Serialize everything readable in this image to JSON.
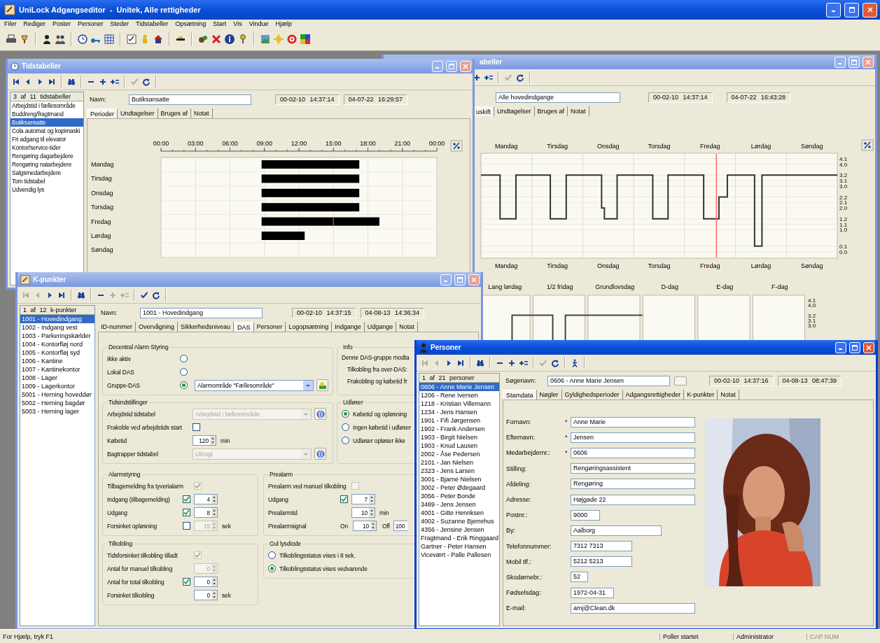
{
  "app": {
    "title": "UniLock Adgangseditor  -  Unitek, Alle rettigheder",
    "menu": [
      "Filer",
      "Rediger",
      "Poster",
      "Personer",
      "Steder",
      "Tidstabeller",
      "Opsætning",
      "Start",
      "Vis",
      "Vindue",
      "Hjælp"
    ]
  },
  "week_window": {
    "title": "abeller",
    "active": false,
    "toolbar": [
      {
        "kind": "add",
        "disabled": false
      },
      {
        "kind": "copy",
        "disabled": false
      },
      {
        "kind": "save",
        "disabled": true
      },
      {
        "kind": "undo",
        "disabled": false
      }
    ],
    "name": "Alle hovedindgange",
    "created": "00-02-10 14:37:14",
    "modified": "04-07-22 16:43:28",
    "tabs": [
      {
        "label": "uskift",
        "selected": true
      },
      {
        "label": "Undtagelser",
        "selected": false
      },
      {
        "label": "Bruges af",
        "selected": false
      },
      {
        "label": "Notat",
        "selected": false
      }
    ],
    "day_headers": [
      "Mandag",
      "Tirsdag",
      "Onsdag",
      "Torsdag",
      "Fredag",
      "Lørdag",
      "Søndag"
    ],
    "level_labels": [
      "4.1",
      "4.0",
      "3.2",
      "3.1",
      "3.0",
      "2.2",
      "2.1",
      "2.0",
      "1.2",
      "1.1",
      "1.0",
      "0.1",
      "0.0"
    ],
    "day_footers": [
      "Mandag",
      "Tirsdag",
      "Onsdag",
      "Torsdag",
      "Fredag",
      "Lørdag",
      "Søndag"
    ],
    "special_days": [
      "Lang lørdag",
      "1/2 fridag",
      "Grundlovsdag",
      "D-dag",
      "E-dag",
      "F-dag"
    ],
    "special_levels": [
      "4.1",
      "4.0",
      "3.2",
      "3.1",
      "3.0"
    ]
  },
  "timetable_window": {
    "title": "Tidstabeller",
    "active": false,
    "toolbar": [
      {
        "kind": "first",
        "disabled": false
      },
      {
        "kind": "prev",
        "disabled": false
      },
      {
        "kind": "next",
        "disabled": false
      },
      {
        "kind": "last",
        "disabled": false
      },
      {
        "kind": "find",
        "disabled": false
      },
      {
        "kind": "delete",
        "disabled": false
      },
      {
        "kind": "add",
        "disabled": false
      },
      {
        "kind": "copy",
        "disabled": false
      },
      {
        "kind": "save",
        "disabled": true
      },
      {
        "kind": "undo",
        "disabled": false
      }
    ],
    "list_header": "3 af 11 tidstabeller",
    "items": [
      {
        "label": "Arbejdstid i fællesområde",
        "selected": false
      },
      {
        "label": "Buddreng/fragtmand",
        "selected": false
      },
      {
        "label": "Butiksansatte",
        "selected": true
      },
      {
        "label": "Cola automat og kopimaski",
        "selected": false
      },
      {
        "label": "Fri adgang til elevator",
        "selected": false
      },
      {
        "label": "Kontor/service-tider",
        "selected": false
      },
      {
        "label": "Rengøring dagarbejdere",
        "selected": false
      },
      {
        "label": "Rengøring natarbejdere",
        "selected": false
      },
      {
        "label": "Salgsmedarbejdere",
        "selected": false
      },
      {
        "label": "Tom tidstabel",
        "selected": false
      },
      {
        "label": "Udvendig lys",
        "selected": false
      }
    ],
    "name_label": "Navn:",
    "name": "Butiksansatte",
    "created": "00-02-10 14:37:14",
    "modified": "04-07-22 16:29:57",
    "tabs": [
      {
        "label": "Perioder",
        "selected": true
      },
      {
        "label": "Undtagelser",
        "selected": false
      },
      {
        "label": "Bruges af",
        "selected": false
      },
      {
        "label": "Notat",
        "selected": false
      }
    ],
    "hour_labels": [
      "00:00",
      "03:00",
      "06:00",
      "09:00",
      "12:00",
      "15:00",
      "18:00",
      "21:00",
      "00:00"
    ],
    "days": [
      "Mandag",
      "Tirsdag",
      "Onsdag",
      "Torsdag",
      "Fredag",
      "Lørdag",
      "Søndag"
    ]
  },
  "kpoint_window": {
    "title": "K-punkter",
    "active": false,
    "toolbar": [
      {
        "kind": "first",
        "disabled": true
      },
      {
        "kind": "prev",
        "disabled": true
      },
      {
        "kind": "next",
        "disabled": false
      },
      {
        "kind": "last",
        "disabled": false
      },
      {
        "kind": "find",
        "disabled": false
      },
      {
        "kind": "delete",
        "disabled": false
      },
      {
        "kind": "add",
        "disabled": true
      },
      {
        "kind": "copy",
        "disabled": true
      },
      {
        "kind": "save",
        "disabled": false
      },
      {
        "kind": "undo",
        "disabled": false
      }
    ],
    "list_header": "1 af 12 k-punkter",
    "items": [
      {
        "label": "1001 - Hovedindgang",
        "selected": true
      },
      {
        "label": "1002 - Indgang vest",
        "selected": false
      },
      {
        "label": "1003 - Parkeringskælder",
        "selected": false
      },
      {
        "label": "1004 - Kontorfløj nord",
        "selected": false
      },
      {
        "label": "1005 - Kontorfløj syd",
        "selected": false
      },
      {
        "label": "1006 - Kantine",
        "selected": false
      },
      {
        "label": "1007 - Kantinekontor",
        "selected": false
      },
      {
        "label": "1008 - Lager",
        "selected": false
      },
      {
        "label": "1009 - Lagerkontor",
        "selected": false
      },
      {
        "label": "5001 - Herning hoveddør",
        "selected": false
      },
      {
        "label": "5002 - Herning bagdør",
        "selected": false
      },
      {
        "label": "5003 - Herning lager",
        "selected": false
      }
    ],
    "name_label": "Navn:",
    "name": "1001 - Hovedindgang",
    "created": "00-02-10 14:37:15",
    "modified": "04-08-13 14:36:34",
    "tabs": [
      {
        "label": "ID-nummer",
        "selected": false
      },
      {
        "label": "Overvågning",
        "selected": false
      },
      {
        "label": "Sikkerhedsniveau",
        "selected": false
      },
      {
        "label": "DAS",
        "selected": true
      },
      {
        "label": "Personer",
        "selected": false
      },
      {
        "label": "Logopsætning",
        "selected": false
      },
      {
        "label": "Indgange",
        "selected": false
      },
      {
        "label": "Udgange",
        "selected": false
      },
      {
        "label": "Notat",
        "selected": false
      }
    ],
    "decentral": {
      "title": "Decentral Alarm Styring",
      "options": [
        {
          "label": "Ikke aktiv",
          "selected": false
        },
        {
          "label": "Lokal DAS",
          "selected": false
        },
        {
          "label": "Gruppe-DAS",
          "selected": true,
          "value": "Alarmområde \"Fællesområde\""
        }
      ]
    },
    "info": {
      "title": "Info",
      "lines": [
        "Denne DAS-gruppe modta",
        "Tilkobling fra over-DAS:",
        "Frakobling og købetid fr"
      ]
    },
    "time_settings": {
      "title": "Tidsindstillinger",
      "rows": [
        {
          "kind": "dropdown",
          "label": "Arbejdstid tidstabel",
          "value": "Arbejdstid i fællesområde",
          "disabled": true
        },
        {
          "kind": "check",
          "label": "Frakoble ved arbejdstids start",
          "checked": false,
          "disabled": false
        },
        {
          "kind": "spin",
          "label": "Købetid",
          "value": "120",
          "unit": "min",
          "disabled": false
        },
        {
          "kind": "dropdown",
          "label": "Bagtrapper tidstabel",
          "value": "Ubrugt",
          "disabled": true
        }
      ]
    },
    "trigger": {
      "title": "Udløser",
      "options": [
        {
          "label": "Købetid og opløsning",
          "selected": true
        },
        {
          "label": "Ingen købetid i udløser",
          "selected": false
        },
        {
          "label": "Udløser opløser ikke",
          "selected": false
        }
      ]
    },
    "alarm": {
      "title": "Alarmstyring",
      "rows": [
        {
          "kind": "check",
          "label": "Tilbagemelding fra tyverialarm",
          "checked": true,
          "disabled": true
        },
        {
          "kind": "check_spin",
          "label": "Indgang (tilbagemelding)",
          "checked": true,
          "disabled": false,
          "value": "4"
        },
        {
          "kind": "check_spin",
          "label": "Udgang",
          "checked": true,
          "disabled": false,
          "value": "8"
        },
        {
          "kind": "check_spin",
          "label": "Forsinket opløsning",
          "checked": false,
          "disabled": true,
          "value": "15",
          "unit": "sek"
        }
      ]
    },
    "prealarm": {
      "title": "Prealarm",
      "rows": [
        {
          "kind": "check",
          "label": "Prealarm ved manuel tilkobling",
          "checked": false,
          "disabled": true
        },
        {
          "kind": "check_spin",
          "label": "Udgang",
          "checked": true,
          "disabled": false,
          "value": "7"
        },
        {
          "kind": "spin",
          "label": "Prealarmtid",
          "value": "10",
          "unit": "min",
          "disabled": false
        },
        {
          "kind": "signal",
          "label": "Prealarmsignal",
          "on_label": "On",
          "on_value": "10",
          "off_label": "Off",
          "off_value": "100"
        }
      ]
    },
    "arming": {
      "title": "Tilkobling",
      "rows": [
        {
          "kind": "check",
          "label": "Tidsforsinket tilkobling tilladt",
          "checked": true,
          "disabled": true
        },
        {
          "kind": "spin",
          "label": "Antal for manuel tilkobling",
          "value": "0",
          "disabled": true
        },
        {
          "kind": "check_spin",
          "label": "Antal for total tilkobling",
          "checked": true,
          "disabled": false,
          "value": "0"
        },
        {
          "kind": "spin",
          "label": "Forsinket tilkobling",
          "value": "0",
          "unit": "sek",
          "disabled": false
        }
      ]
    },
    "led": {
      "title": "Gul lysdiode",
      "options": [
        {
          "label": "Tilkoblingsstatus vises i 8 sek.",
          "selected": false
        },
        {
          "label": "Tilkoblingsstatus vises vedvarende",
          "selected": true
        }
      ]
    }
  },
  "person_window": {
    "title": "Personer",
    "active": true,
    "toolbar": [
      {
        "kind": "first",
        "disabled": true
      },
      {
        "kind": "prev",
        "disabled": true
      },
      {
        "kind": "next",
        "disabled": false
      },
      {
        "kind": "last",
        "disabled": false
      },
      {
        "kind": "find",
        "disabled": false
      },
      {
        "kind": "delete",
        "disabled": false
      },
      {
        "kind": "add",
        "disabled": false
      },
      {
        "kind": "copy",
        "disabled": false
      },
      {
        "kind": "save",
        "disabled": true
      },
      {
        "kind": "undo",
        "disabled": false
      },
      {
        "kind": "person",
        "disabled": false
      }
    ],
    "list_header": "1 af 21 personer",
    "items": [
      {
        "label": "0606 - Anne Marie Jensen",
        "selected": true
      },
      {
        "label": "1206 - Rene Iversen",
        "selected": false
      },
      {
        "label": "1218 - Kristian Villemann",
        "selected": false
      },
      {
        "label": "1234 - Jens Hansen",
        "selected": false
      },
      {
        "label": "1901 - Fifi Jørgensen",
        "selected": false
      },
      {
        "label": "1902 - Frank Andersen",
        "selected": false
      },
      {
        "label": "1903 - Birgit Nielsen",
        "selected": false
      },
      {
        "label": "1903 - Knud Lausen",
        "selected": false
      },
      {
        "label": "2002 - Åse Pedersen",
        "selected": false
      },
      {
        "label": "2101 - Jan Nielsen",
        "selected": false
      },
      {
        "label": "2323 - Jens Larsen",
        "selected": false
      },
      {
        "label": "3001 - Bjarne Nielsen",
        "selected": false
      },
      {
        "label": "3002 - Peter Ødegaard",
        "selected": false
      },
      {
        "label": "3056 - Peter Bonde",
        "selected": false
      },
      {
        "label": "3489 - Jens Jensen",
        "selected": false
      },
      {
        "label": "4001 - Gitte Henriksen",
        "selected": false
      },
      {
        "label": "4002 - Suzanne Bjerrehus",
        "selected": false
      },
      {
        "label": "4356 - Jensine Jensen",
        "selected": false
      },
      {
        "label": "Fragtmand - Erik Ringgaard",
        "selected": false
      },
      {
        "label": "Gartner - Peter Hansen",
        "selected": false
      },
      {
        "label": "Vicevært - Palle Pallesen",
        "selected": false
      }
    ],
    "search_label": "Søgenavn:",
    "search_value": "0606 - Anne Marie Jensen",
    "created": "00-02-10 14:37:16",
    "modified": "04-08-13 08:47:39",
    "tabs": [
      {
        "label": "Stamdata",
        "selected": true
      },
      {
        "label": "Nøgler",
        "selected": false
      },
      {
        "label": "Gyldighedsperioder",
        "selected": false
      },
      {
        "label": "Adgangsrettigheder",
        "selected": false
      },
      {
        "label": "K-punkter",
        "selected": false
      },
      {
        "label": "Notat",
        "selected": false
      }
    ],
    "fields": [
      {
        "label": "Fornavn:",
        "marker": "*",
        "value": "Anne Marie"
      },
      {
        "label": "Efternavn:",
        "marker": "*",
        "value": "Jensen"
      },
      {
        "label": "Medarbejdernr.:",
        "marker": "*",
        "value": "0606"
      },
      {
        "label": "Stilling:",
        "value": "Rengøringsassistent"
      },
      {
        "label": "Afdeling:",
        "value": "Rengøring"
      },
      {
        "label": "Adresse:",
        "value": "Højgade 22"
      },
      {
        "label": "Postnr.:",
        "value": "9000"
      },
      {
        "label": "By:",
        "value": "Aalborg"
      },
      {
        "label": "Telefonnummer:",
        "value": "7312 7313"
      },
      {
        "label": "Mobil tlf.:",
        "value": "5212 5213"
      },
      {
        "label": "Skodørnebr.:",
        "value": "52"
      },
      {
        "label": "Fødselsdag:",
        "value": "1972-04-31"
      },
      {
        "label": "E-mail:",
        "value": "amj@Clean.dk"
      }
    ]
  },
  "status_bar": [
    {
      "text": "For Hjælp, tryk F1",
      "disabled": false
    },
    {
      "text": "Poller startet",
      "disabled": false
    },
    {
      "text": "Administrator",
      "disabled": false
    },
    {
      "text": "CAP NUM",
      "disabled": true
    }
  ]
}
